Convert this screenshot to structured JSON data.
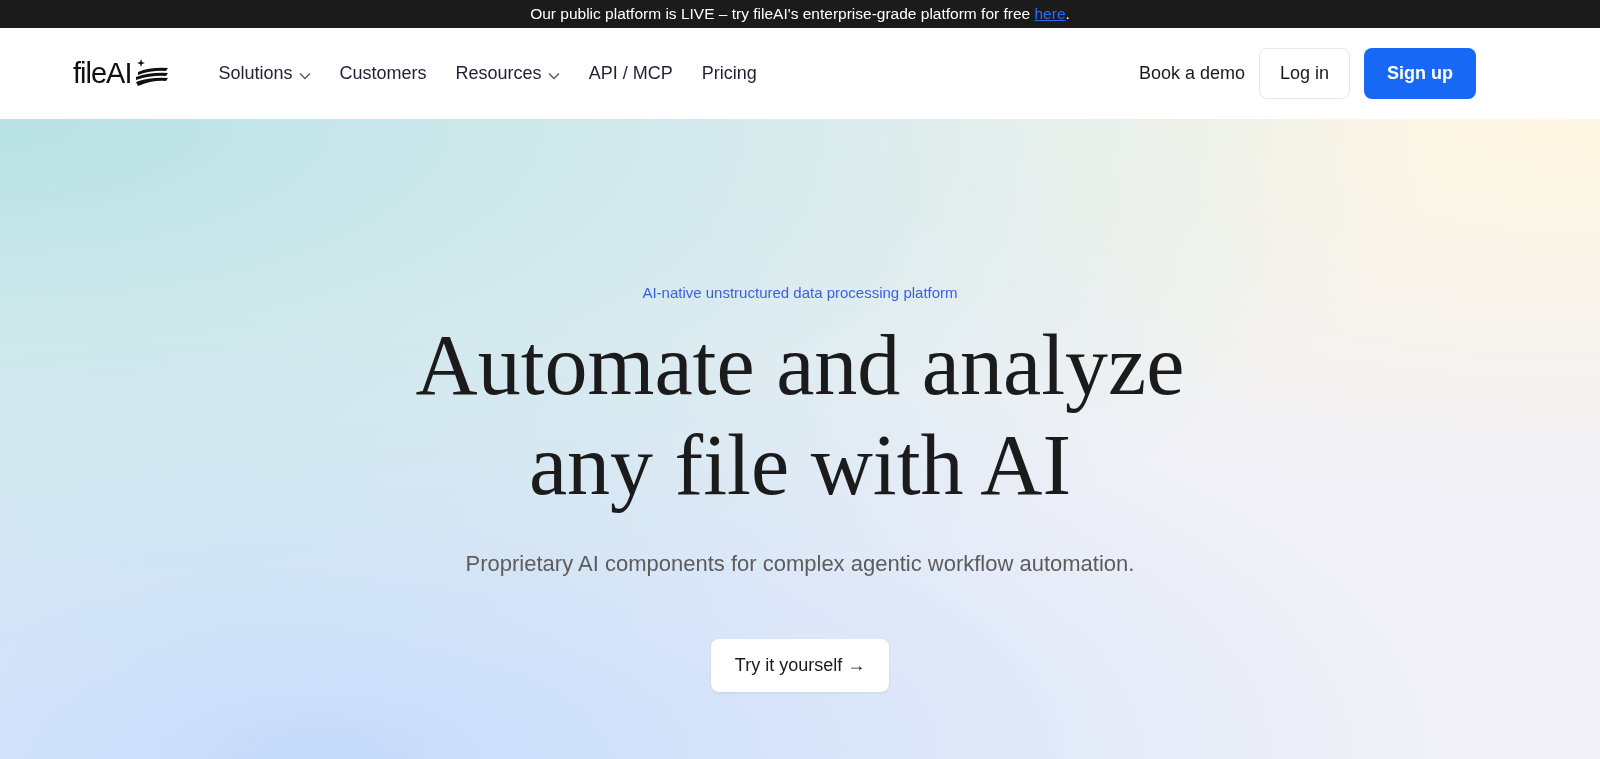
{
  "banner": {
    "text": "Our public platform is LIVE – try fileAI's enterprise-grade platform for free",
    "link": "here",
    "after": "."
  },
  "nav": {
    "logo": "fileAI",
    "items": [
      {
        "label": "Solutions",
        "dropdown": true
      },
      {
        "label": "Customers",
        "dropdown": false
      },
      {
        "label": "Resources",
        "dropdown": true
      },
      {
        "label": "API / MCP",
        "dropdown": false
      },
      {
        "label": "Pricing",
        "dropdown": false
      }
    ],
    "actions": [
      {
        "label": "Book a demo",
        "kind": "link"
      },
      {
        "label": "Log in",
        "kind": "outline"
      },
      {
        "label": "Sign up",
        "kind": "primary"
      }
    ]
  },
  "hero": {
    "eyebrow": "AI-native unstructured data processing platform",
    "heading_lines": [
      "Automate and analyze",
      "any file with AI"
    ],
    "subtitle": "Proprietary AI components for complex agentic workflow automation.",
    "cta": {
      "label": "Try it yourself",
      "arrow": "→"
    }
  }
}
